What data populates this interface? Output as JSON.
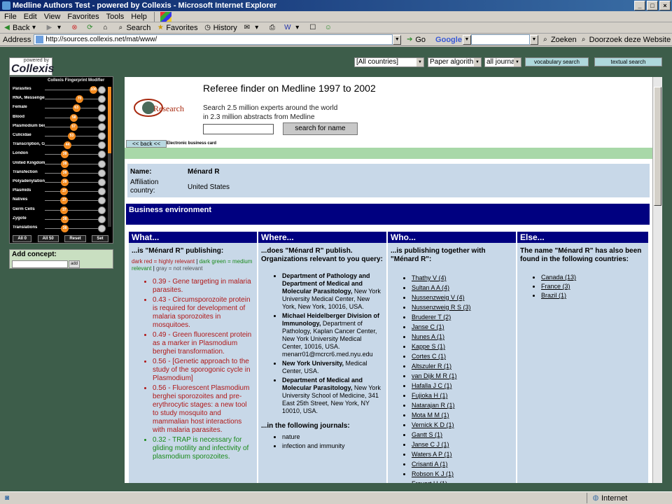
{
  "window": {
    "title": "Medline Authors Test - powered by Collexis - Microsoft Internet Explorer"
  },
  "menu": [
    "File",
    "Edit",
    "View",
    "Favorites",
    "Tools",
    "Help"
  ],
  "toolbar": {
    "back": "Back",
    "search": "Search",
    "favorites": "Favorites",
    "history": "History"
  },
  "address": {
    "label": "Address",
    "url": "http://sources.collexis.net/mat/www/",
    "go": "Go"
  },
  "googlebar": {
    "brand": "Google",
    "zoeken": "Zoeken",
    "doorzoek": "Doorzoek deze Website"
  },
  "status": {
    "zone": "Internet"
  },
  "logo": {
    "powered": "powered by",
    "name": "Collexis"
  },
  "fingerprint": {
    "header": "Collexis Fingerprint Modifier",
    "rows": [
      {
        "label": "Parasites",
        "value": 100
      },
      {
        "label": "RNA, Messenger",
        "value": 70
      },
      {
        "label": "Female",
        "value": 63
      },
      {
        "label": "Blood",
        "value": 58
      },
      {
        "label": "Plasmodium ber",
        "value": 57
      },
      {
        "label": "Culicidae",
        "value": 53
      },
      {
        "label": "Transcription, G",
        "value": 44
      },
      {
        "label": "London",
        "value": 38
      },
      {
        "label": "United Kingdom",
        "value": 38
      },
      {
        "label": "Transfection",
        "value": 38
      },
      {
        "label": "Polyadenylation",
        "value": 38
      },
      {
        "label": "Plasmids",
        "value": 37
      },
      {
        "label": "Natives",
        "value": 37
      },
      {
        "label": "Germ Cells",
        "value": 37
      },
      {
        "label": "Zygote",
        "value": 38
      },
      {
        "label": "Translations",
        "value": 38
      }
    ],
    "buttons": [
      "All 0",
      "All 50",
      "Reset",
      "Set"
    ]
  },
  "concept": {
    "label": "Add concept:",
    "add": "add"
  },
  "filters": {
    "country": "[All countries]",
    "algorithm": "Paper algorith",
    "journals": "all journa",
    "vocab_btn": "vocabulary search",
    "text_btn": "textual search"
  },
  "page": {
    "title": "Referee finder on Medline 1997 to 2002",
    "logo_text": "Research",
    "desc1": "Search 2.5 million experts around the world",
    "desc2": "in 2.3 million abstracts from Medline",
    "search_btn": "search for name",
    "back": "<< back <<",
    "ebc": "Electronic business card",
    "name_label": "Name:",
    "name_value": "Ménard R",
    "aff_label1": "Affiliation",
    "aff_label2": "country:",
    "aff_value": "United States",
    "biz": "Business environment"
  },
  "what": {
    "head": "What...",
    "lead": "...is \"Ménard R\" publishing:",
    "leg_red": "dark red = highly relevant",
    "leg_sep1": " | ",
    "leg_green": "dark green = medium relevant",
    "leg_sep2": " | ",
    "leg_gray": "gray = not relevant",
    "items": [
      {
        "t": "0.39 - Gene targeting in malaria parasites.",
        "c": "red"
      },
      {
        "t": "0.43 - Circumsporozoite protein is required for development of malaria sporozoites in mosquitoes.",
        "c": "red"
      },
      {
        "t": "0.49 - Green fluorescent protein as a marker in Plasmodium berghei transformation.",
        "c": "red"
      },
      {
        "t": "0.56 - [Genetic approach to the study of the sporogonic cycle in Plasmodium]",
        "c": "red"
      },
      {
        "t": "0.56 - Fluorescent Plasmodium berghei sporozoites and pre-erythrocytic stages: a new tool to study mosquito and mammalian host interactions with malaria parasites.",
        "c": "red"
      },
      {
        "t": "0.32 - TRAP is necessary for gliding motility and infectivity of plasmodium sporozoites.",
        "c": "green"
      }
    ]
  },
  "where": {
    "head": "Where...",
    "lead": "...does \"Ménard R\" publish. Organizations relevant to you query:",
    "orgs": [
      {
        "b": "Department of Pathology and Department of Medical and Molecular Parasitology,",
        "r": " New York University Medical Center, New York, New York, 10016, USA."
      },
      {
        "b": "Michael Heidelberger Division of Immunology,",
        "r": " Department of Pathology, Kaplan Cancer Center, New York University Medical Center, 10016, USA. menarr01@mcrcr6.med.nyu.edu"
      },
      {
        "b": "New York University,",
        "r": " Medical Center, USA."
      },
      {
        "b": "Department of Medical and Molecular Parasitology,",
        "r": " New York University School of Medicine, 341 East 25th Street, New York, NY 10010, USA."
      }
    ],
    "journals_lead": "...in the following journals:",
    "journals": [
      "nature",
      "infection and immunity"
    ]
  },
  "who": {
    "head": "Who...",
    "lead": "...is publishing together with \"Ménard R\":",
    "people": [
      "Thathy V (4)",
      "Sultan A A (4)",
      "Nussenzweig V (4)",
      "Nussenzweig R S (3)",
      "Bruderer T (2)",
      "Janse C (1)",
      "Nunes A (1)",
      "Kappe S (1)",
      "Cortes C (1)",
      "Altszuler R (1)",
      "van Dijk M R (1)",
      "Hafalla J C (1)",
      "Fujioka H (1)",
      "Natarajan R (1)",
      "Mota M M (1)",
      "Vernick K D (1)",
      "Gantt S (1)",
      "Janse C J (1)",
      "Waters A P (1)",
      "Crisanti A (1)",
      "Robson K J (1)",
      "Frevert U (1)"
    ]
  },
  "else": {
    "head": "Else...",
    "lead": "The name \"Ménard R\" has also been found in the following countries:",
    "countries": [
      "Canada (13)",
      "France (3)",
      "Brazil (1)"
    ]
  }
}
